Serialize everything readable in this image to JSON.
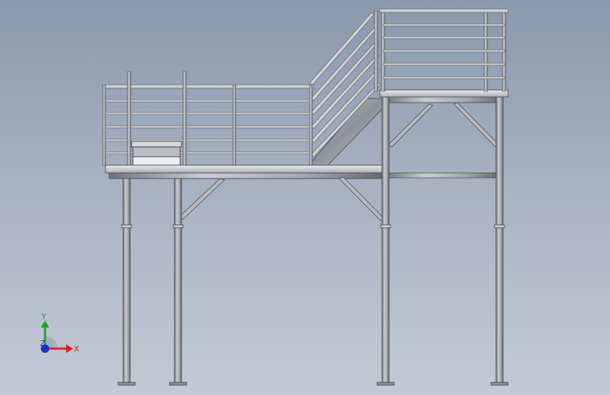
{
  "viewport": {
    "background_top": "#8a98ad",
    "background_bottom": "#c3cad5"
  },
  "model": {
    "steel_color": "#9aa0a6",
    "steel_dark": "#5c6166",
    "steel_light": "#d7dadd"
  },
  "triad": {
    "x_label": "X",
    "y_label": "Y",
    "z_label": "Z",
    "x_color": "#e0201b",
    "y_color": "#1fa31f",
    "z_color": "#1c2fd1"
  }
}
